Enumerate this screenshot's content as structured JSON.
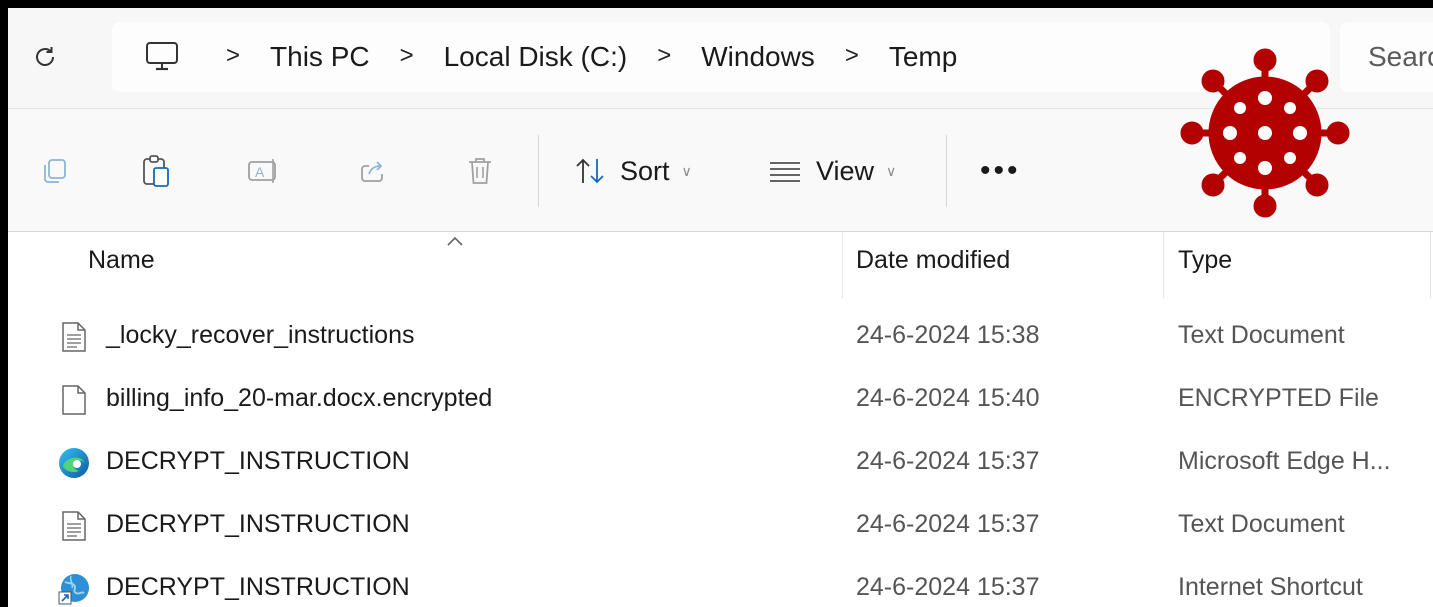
{
  "address_bar": {
    "breadcrumbs": [
      "This PC",
      "Local Disk (C:)",
      "Windows",
      "Temp"
    ],
    "separator": ">",
    "search_placeholder": "Search"
  },
  "command_bar": {
    "sort_label": "Sort",
    "view_label": "View",
    "more_label": "•••"
  },
  "file_list": {
    "columns": {
      "name": "Name",
      "date": "Date modified",
      "type": "Type"
    },
    "rows": [
      {
        "name": "_locky_recover_instructions",
        "date": "24-6-2024 15:38",
        "type": "Text Document",
        "icon": "text-file-icon"
      },
      {
        "name": "billing_info_20-mar.docx.encrypted",
        "date": "24-6-2024 15:40",
        "type": "ENCRYPTED File",
        "icon": "blank-file-icon"
      },
      {
        "name": "DECRYPT_INSTRUCTION",
        "date": "24-6-2024 15:37",
        "type": "Microsoft Edge H...",
        "icon": "edge-icon"
      },
      {
        "name": "DECRYPT_INSTRUCTION",
        "date": "24-6-2024 15:37",
        "type": "Text Document",
        "icon": "text-file-icon"
      },
      {
        "name": "DECRYPT_INSTRUCTION",
        "date": "24-6-2024 15:37",
        "type": "Internet Shortcut",
        "icon": "internet-shortcut-icon"
      }
    ]
  },
  "colors": {
    "virus": "#b30000",
    "accent": "#0f6cbd"
  }
}
